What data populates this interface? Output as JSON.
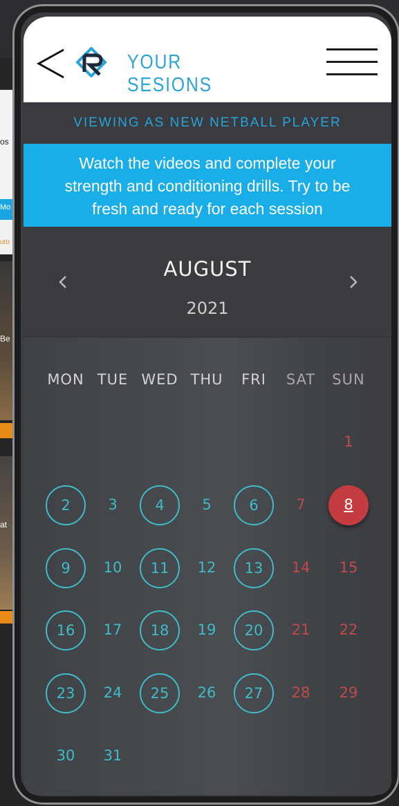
{
  "header": {
    "title": "YOUR SESIONS"
  },
  "viewing_label": "VIEWING AS NEW NETBALL PLAYER",
  "info_banner": "Watch the videos and complete your strength and conditioning drills. Try to be fresh and ready for each session",
  "calendar": {
    "month": "AUGUST",
    "year": "2021",
    "weekdays": [
      "MON",
      "TUE",
      "WED",
      "THU",
      "FRI",
      "SAT",
      "SUN"
    ],
    "first_weekday_index": 6,
    "days_in_month": 31,
    "ringed_days": [
      2,
      4,
      6,
      9,
      11,
      13,
      16,
      18,
      20,
      23,
      25,
      27
    ],
    "selected_day": 8
  },
  "background_snippets": [
    "os",
    "Mo",
    "uto",
    "Be",
    "at"
  ],
  "colors": {
    "accent_blue": "#2ba4d6",
    "banner_blue": "#1aaee9",
    "day_teal": "#3fbcc6",
    "weekend_red": "#c24a4a",
    "selected_red": "#c43c3f"
  }
}
